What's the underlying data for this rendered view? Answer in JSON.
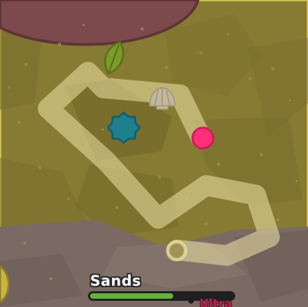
{
  "world": {
    "biome_color": "#877a33",
    "dark_terrain_color": "#756a2c",
    "border_color": "#cdbf48",
    "rock_color": "#7a6a63",
    "boulder_color": "#7c4a4d",
    "trail_color": "#efe4a6"
  },
  "player": {
    "icon": "pink-circle-player-icon",
    "color": "#ff2f7a"
  },
  "mobs": [
    {
      "icon": "blue-starfish-icon",
      "color": "#1e7f8e"
    },
    {
      "icon": "green-leaf-icon",
      "color": "#7d9b2a"
    },
    {
      "icon": "shell-icon",
      "color": "#c3b79c"
    }
  ],
  "target": {
    "name": "Sands",
    "health_fraction": 0.58,
    "rarity": "Ultra",
    "rarity_color": "#c71a4c"
  }
}
